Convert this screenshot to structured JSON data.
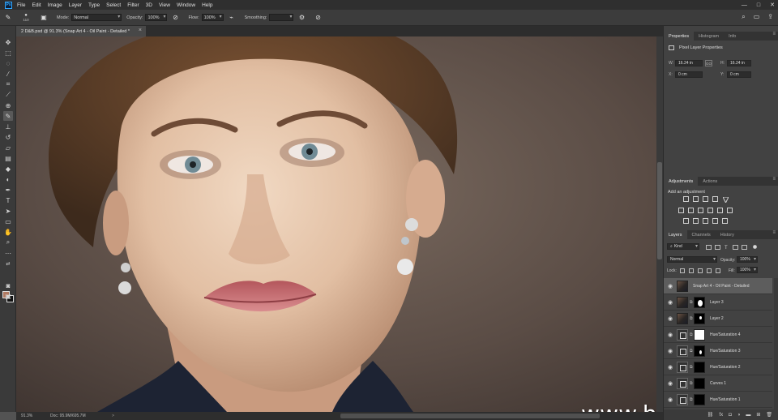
{
  "app": {
    "logo": "Ps",
    "menu": [
      "File",
      "Edit",
      "Image",
      "Layer",
      "Type",
      "Select",
      "Filter",
      "3D",
      "View",
      "Window",
      "Help"
    ],
    "window_controls": [
      "—",
      "□",
      "✕"
    ]
  },
  "options_bar": {
    "brush_size": "110",
    "mode_label": "Mode:",
    "mode_value": "Normal",
    "opacity_label": "Opacity:",
    "opacity_value": "100%",
    "flow_label": "Flow:",
    "flow_value": "100%",
    "smoothing_label": "Smoothing:",
    "smoothing_value": ""
  },
  "document": {
    "tab_title": "2 D&B.psd @ 91.3% (Snap Art 4 - Oil Paint - Detailed *",
    "close": "×"
  },
  "status": {
    "zoom": "91.3%",
    "doc_size": "Doc: 95.9M/695.7M",
    "arrow": ">"
  },
  "watermark": "www.hunis.com",
  "properties": {
    "tabs": [
      "Properties",
      "Histogram",
      "Info"
    ],
    "title": "Pixel Layer Properties",
    "w_label": "W:",
    "w_value": "16.24 in",
    "h_label": "H:",
    "h_value": "16.24 in",
    "x_label": "X:",
    "x_value": "0 cm",
    "y_label": "Y:",
    "y_value": "0 cm",
    "link_label": "GO"
  },
  "adjustments": {
    "tabs": [
      "Adjustments",
      "Actions"
    ],
    "title": "Add an adjustment"
  },
  "layers": {
    "tabs": [
      "Layers",
      "Channels",
      "History"
    ],
    "filter_kind": "Kind",
    "blend_mode": "Normal",
    "opacity_label": "Opacity:",
    "opacity_value": "100%",
    "lock_label": "Lock:",
    "fill_label": "Fill:",
    "fill_value": "100%",
    "items": [
      {
        "name": "Snap Art 4 - Oil Paint - Detailed",
        "thumb": "photo",
        "mask": "none",
        "selected": true
      },
      {
        "name": "Layer 3",
        "thumb": "photo",
        "mask": "black-blob",
        "selected": false
      },
      {
        "name": "Layer 2",
        "thumb": "photo",
        "mask": "black-blob",
        "selected": false
      },
      {
        "name": "Hue/Saturation 4",
        "thumb": "adj",
        "mask": "white",
        "selected": false
      },
      {
        "name": "Hue/Saturation 3",
        "thumb": "adj",
        "mask": "black-blob",
        "selected": false
      },
      {
        "name": "Hue/Saturation 2",
        "thumb": "adj",
        "mask": "black",
        "selected": false
      },
      {
        "name": "Curves 1",
        "thumb": "adj",
        "mask": "black",
        "selected": false
      },
      {
        "name": "Hue/Saturation 1",
        "thumb": "adj",
        "mask": "black",
        "selected": false
      }
    ],
    "bottom_icons": [
      "link-icon",
      "fx-icon",
      "mask-icon",
      "adjustment-icon",
      "folder-icon",
      "new-layer-icon",
      "trash-icon"
    ]
  },
  "colors": {
    "foreground": "#b07a62",
    "background": "#111111",
    "accent": "#31a8ff"
  }
}
